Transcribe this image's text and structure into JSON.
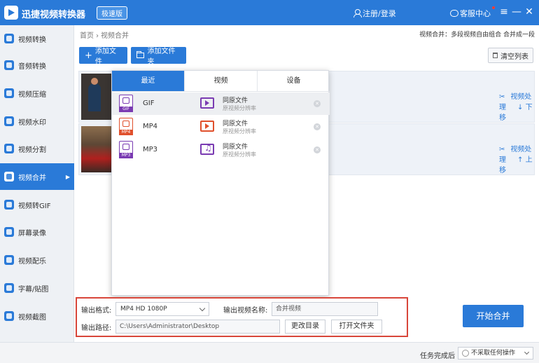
{
  "app": {
    "title": "迅捷视频转换器",
    "edition": "极速版",
    "login": "注册/登录",
    "service": "客服中心",
    "window_controls": [
      "≡",
      "—",
      "✕"
    ]
  },
  "sidebar": {
    "items": [
      {
        "label": "视频转换",
        "icon": "video-convert-icon"
      },
      {
        "label": "音频转换",
        "icon": "audio-convert-icon"
      },
      {
        "label": "视频压缩",
        "icon": "video-compress-icon"
      },
      {
        "label": "视频水印",
        "icon": "watermark-icon"
      },
      {
        "label": "视频分割",
        "icon": "split-icon"
      },
      {
        "label": "视频合并",
        "icon": "merge-icon",
        "active": true
      },
      {
        "label": "视频转GIF",
        "icon": "gif-icon"
      },
      {
        "label": "屏幕录像",
        "icon": "screen-record-icon"
      },
      {
        "label": "视频配乐",
        "icon": "music-icon"
      },
      {
        "label": "字幕/贴图",
        "icon": "subtitle-icon"
      },
      {
        "label": "视频截图",
        "icon": "screenshot-icon"
      }
    ]
  },
  "breadcrumb": {
    "home": "首页",
    "separator": "›",
    "current": "视频合并"
  },
  "hint": "视频合并：多段视频自由组合 合并成一段",
  "toolbar": {
    "add_file": "添加文件",
    "add_folder": "添加文件夹",
    "clear_list": "清空列表"
  },
  "files": [
    {
      "actions": [
        "视频处理",
        "下移"
      ]
    },
    {
      "actions": [
        "视频处理",
        "上移"
      ]
    }
  ],
  "format_popup": {
    "tabs": [
      "最近",
      "视频",
      "设备"
    ],
    "active_tab": "最近",
    "formats": [
      {
        "name": "GIF",
        "tag": "GIF",
        "quality_title": "同原文件",
        "quality_sub": "原视频分辨率"
      },
      {
        "name": "MP4",
        "tag": "MP4",
        "quality_title": "同原文件",
        "quality_sub": "原视频分辨率"
      },
      {
        "name": "MP3",
        "tag": "MP3",
        "quality_title": "同原文件",
        "quality_sub": "原视频分辨率"
      }
    ]
  },
  "output": {
    "format_label": "输出格式:",
    "format_value": "MP4  HD 1080P",
    "name_label": "输出视频名称:",
    "name_value": "合并视频",
    "path_label": "输出路径:",
    "path_value": "C:\\Users\\Administrator\\Desktop",
    "change_dir": "更改目录",
    "open_folder": "打开文件夹"
  },
  "start_button": "开始合并",
  "status": {
    "task_label": "任务完成后",
    "task_value": "不采取任何操作"
  },
  "colors": {
    "accent": "#2a7ad8",
    "highlight_border": "#d8463a",
    "gif": "#7a3bb2",
    "mp4": "#e0502c"
  }
}
